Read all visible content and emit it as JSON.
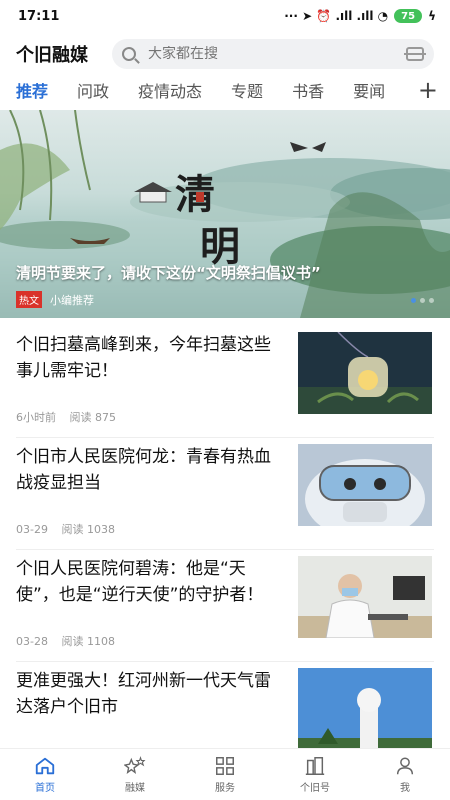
{
  "status_bar": {
    "time": "17:11",
    "icons": "··· ➤ ⏰ .ıll .ıll ◔",
    "battery": "75",
    "charging": "ϟ"
  },
  "header": {
    "title": "个旧融媒",
    "search_placeholder": "大家都在搜"
  },
  "tabs": [
    {
      "label": "推荐",
      "active": true
    },
    {
      "label": "问政"
    },
    {
      "label": "疫情动态"
    },
    {
      "label": "专题"
    },
    {
      "label": "书香"
    },
    {
      "label": "要闻"
    }
  ],
  "tab_add": "+",
  "banner": {
    "caption": "清明节要来了，请收下这份“文明祭扫倡议书”",
    "art_text_1": "清",
    "art_text_2": "明",
    "tag": "热文",
    "source": "小编推荐"
  },
  "news": [
    {
      "title": "个旧扫墓高峰到来，今年扫墓这些事儿需牢记！",
      "time": "6小时前",
      "reads": "阅读 875",
      "thumb_icon": "lantern-image"
    },
    {
      "title": "个旧市人民医院何龙：青春有热血 战疫显担当",
      "time": "03-29",
      "reads": "阅读 1038",
      "thumb_icon": "medic-goggles-image"
    },
    {
      "title": "个旧人民医院何碧涛：他是“天使”，也是“逆行天使”的守护者！",
      "time": "03-28",
      "reads": "阅读 1108",
      "thumb_icon": "doctor-desk-image"
    },
    {
      "title": "更准更强大！红河州新一代天气雷达落户个旧市",
      "time": "",
      "reads": "",
      "thumb_icon": "radar-tower-image"
    }
  ],
  "bottom_nav": [
    {
      "label": "首页",
      "icon": "home-icon",
      "active": true
    },
    {
      "label": "融媒",
      "icon": "stars-icon"
    },
    {
      "label": "服务",
      "icon": "grid-icon"
    },
    {
      "label": "个旧号",
      "icon": "buildings-icon"
    },
    {
      "label": "我",
      "icon": "user-icon"
    }
  ],
  "colors": {
    "accent": "#2a6fd6",
    "hot_tag": "#d9322a"
  }
}
